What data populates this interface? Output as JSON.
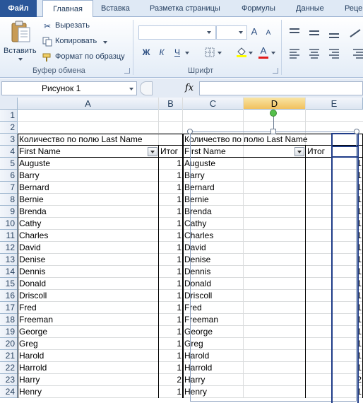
{
  "ribbon": {
    "tabs": [
      "Файл",
      "Главная",
      "Вставка",
      "Разметка страницы",
      "Формулы",
      "Данные",
      "Рецензирование"
    ],
    "clipboard": {
      "paste_label": "Вставить",
      "cut_label": "Вырезать",
      "copy_label": "Копировать",
      "format_painter_label": "Формат по образцу",
      "group_label": "Буфер обмена"
    },
    "font": {
      "font_name": "",
      "font_size": "",
      "bold": "Ж",
      "italic": "К",
      "underline": "Ч",
      "grow": "A",
      "shrink": "A",
      "font_color": "A",
      "group_label": "Шрифт"
    }
  },
  "formula_bar": {
    "name_box": "Рисунок 1",
    "fx_label": "fx",
    "formula": ""
  },
  "sheet": {
    "columns": [
      "A",
      "B",
      "C",
      "D",
      "E"
    ],
    "selected_columns": [
      "D"
    ],
    "row_numbers": [
      "1",
      "2",
      "3",
      "4",
      "5",
      "6",
      "7",
      "8",
      "9",
      "10",
      "11",
      "12",
      "13",
      "14",
      "15",
      "16",
      "17",
      "18",
      "19",
      "20",
      "21",
      "22",
      "23",
      "24"
    ],
    "pivot_left": {
      "title": "Количество по полю Last Name",
      "row_field": "First Name",
      "total_header": "Итог"
    },
    "pivot_right": {
      "title": "Количество по полю Last Name",
      "row_field": "First Name",
      "total_header": "Итог"
    },
    "rows": [
      {
        "name": "Auguste",
        "count": "1"
      },
      {
        "name": "Barry",
        "count": "1"
      },
      {
        "name": "Bernard",
        "count": "1"
      },
      {
        "name": "Bernie",
        "count": "1"
      },
      {
        "name": "Brenda",
        "count": "1"
      },
      {
        "name": "Cathy",
        "count": "1"
      },
      {
        "name": "Charles",
        "count": "1"
      },
      {
        "name": "David",
        "count": "1"
      },
      {
        "name": "Denise",
        "count": "1"
      },
      {
        "name": "Dennis",
        "count": "1"
      },
      {
        "name": "Donald",
        "count": "1"
      },
      {
        "name": "Driscoll",
        "count": "1"
      },
      {
        "name": "Fred",
        "count": "1"
      },
      {
        "name": "Freeman",
        "count": "1"
      },
      {
        "name": "George",
        "count": "1"
      },
      {
        "name": "Greg",
        "count": "1"
      },
      {
        "name": "Harold",
        "count": "1"
      },
      {
        "name": "Harrold",
        "count": "1"
      },
      {
        "name": "Harry",
        "count": "2"
      },
      {
        "name": "Henry",
        "count": "1"
      }
    ]
  },
  "colors": {
    "file_tab": "#2a5699",
    "selection_border": "#1f3c88",
    "rotate_handle": "#55c04b",
    "header_selected": "#f1c15f"
  }
}
